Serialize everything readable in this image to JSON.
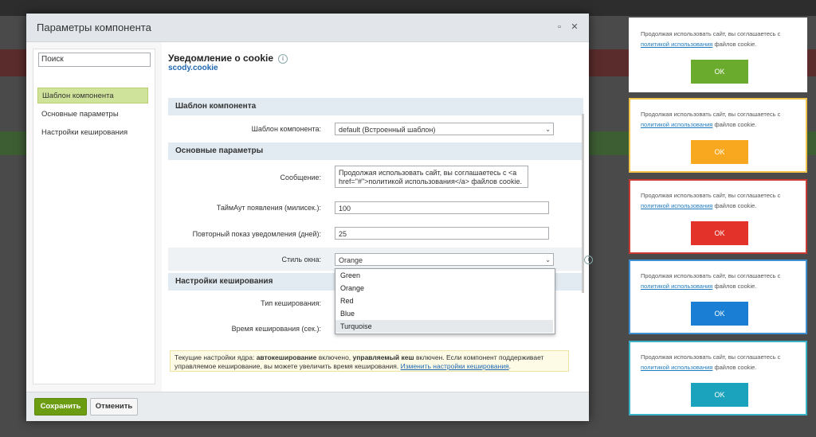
{
  "dialog": {
    "title": "Параметры компонента",
    "minimize_symbol": "▫",
    "close_symbol": "✕"
  },
  "sidebar": {
    "search_placeholder": "Поиск",
    "items": [
      {
        "label": "Шаблон компонента",
        "active": true
      },
      {
        "label": "Основные параметры",
        "active": false
      },
      {
        "label": "Настройки кеширования",
        "active": false
      }
    ]
  },
  "component": {
    "title": "Уведомление о cookie",
    "code": "scody.cookie",
    "info_symbol": "i"
  },
  "sections": {
    "template": "Шаблон компонента",
    "main": "Основные параметры",
    "cache": "Настройки кеширования"
  },
  "fields": {
    "template_label": "Шаблон компонента:",
    "template_value": "default (Встроенный шаблон)",
    "message_label": "Сообщение:",
    "message_value": "Продолжая использовать сайт, вы соглашаетесь с <a href=\"#\">политикой использования</a> файлов cookie.",
    "timeout_label": "ТаймАут появления (милисек.):",
    "timeout_value": "100",
    "repeat_label": "Повторный показ уведомления (дней):",
    "repeat_value": "25",
    "style_label": "Стиль окна:",
    "style_value": "Orange",
    "cache_type_label": "Тип кеширования:",
    "cache_time_label": "Время кеширования (сек.):"
  },
  "style_options": [
    "Green",
    "Orange",
    "Red",
    "Blue",
    "Turquoise"
  ],
  "note": {
    "prefix": "Текущие настройки ядра: ",
    "auto": "автокеширование",
    "mid1": " включено, ",
    "managed": "управляемый кеш",
    "mid2": " включен. Если компонент поддерживает управляемое кеширование, вы можете увеличить время кеширования. ",
    "link": "Изменить настройки кеширования",
    "suffix": "."
  },
  "footer": {
    "save": "Сохранить",
    "cancel": "Отменить"
  },
  "notices": [
    {
      "style": "Green",
      "text_before": "Продолжая использовать сайт, вы соглашаетесь с ",
      "link": "политикой использования",
      "text_after": " файлов cookie.",
      "button": "OK",
      "color": "#6aab2e",
      "border": "#ffffff"
    },
    {
      "style": "Orange",
      "text_before": "Продолжая использовать сайт, вы соглашаетесь с ",
      "link": "политикой использования",
      "text_after": " файлов cookie.",
      "button": "OK",
      "color": "#f7a81f",
      "border": "#f0c34a"
    },
    {
      "style": "Red",
      "text_before": "Продолжая использовать сайт, вы соглашаетесь с ",
      "link": "политикой использования",
      "text_after": " файлов cookie.",
      "button": "OK",
      "color": "#e2322a",
      "border": "#c93a35"
    },
    {
      "style": "Blue",
      "text_before": "Продолжая использовать сайт, вы соглашаетесь с ",
      "link": "политикой использования",
      "text_after": " файлов cookie.",
      "button": "OK",
      "color": "#1a7fd4",
      "border": "#3d8fd1"
    },
    {
      "style": "Turquoise",
      "text_before": "Продолжая использовать сайт, вы соглашаетесь с ",
      "link": "политикой использования",
      "text_after": " файлов cookie.",
      "button": "OK",
      "color": "#1ba2bd",
      "border": "#3ab3c7"
    }
  ]
}
